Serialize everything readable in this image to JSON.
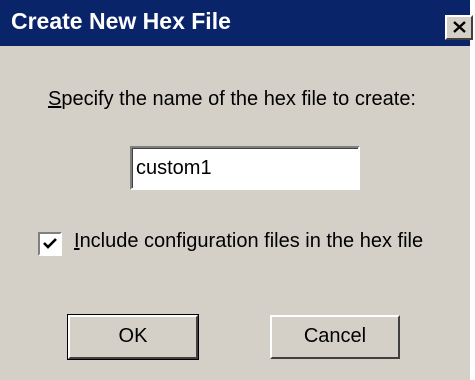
{
  "dialog": {
    "title": "Create New Hex File",
    "prompt_mnemonic": "S",
    "prompt_rest": "pecify the name of the hex file to create:",
    "hex_name_value": "custom1",
    "checkbox_checked": true,
    "checkbox_mnemonic": "I",
    "checkbox_rest": "nclude configuration files in the hex file",
    "ok_label": "OK",
    "cancel_label": "Cancel",
    "icons": {
      "close": "close-icon",
      "check": "checkmark-icon"
    }
  }
}
